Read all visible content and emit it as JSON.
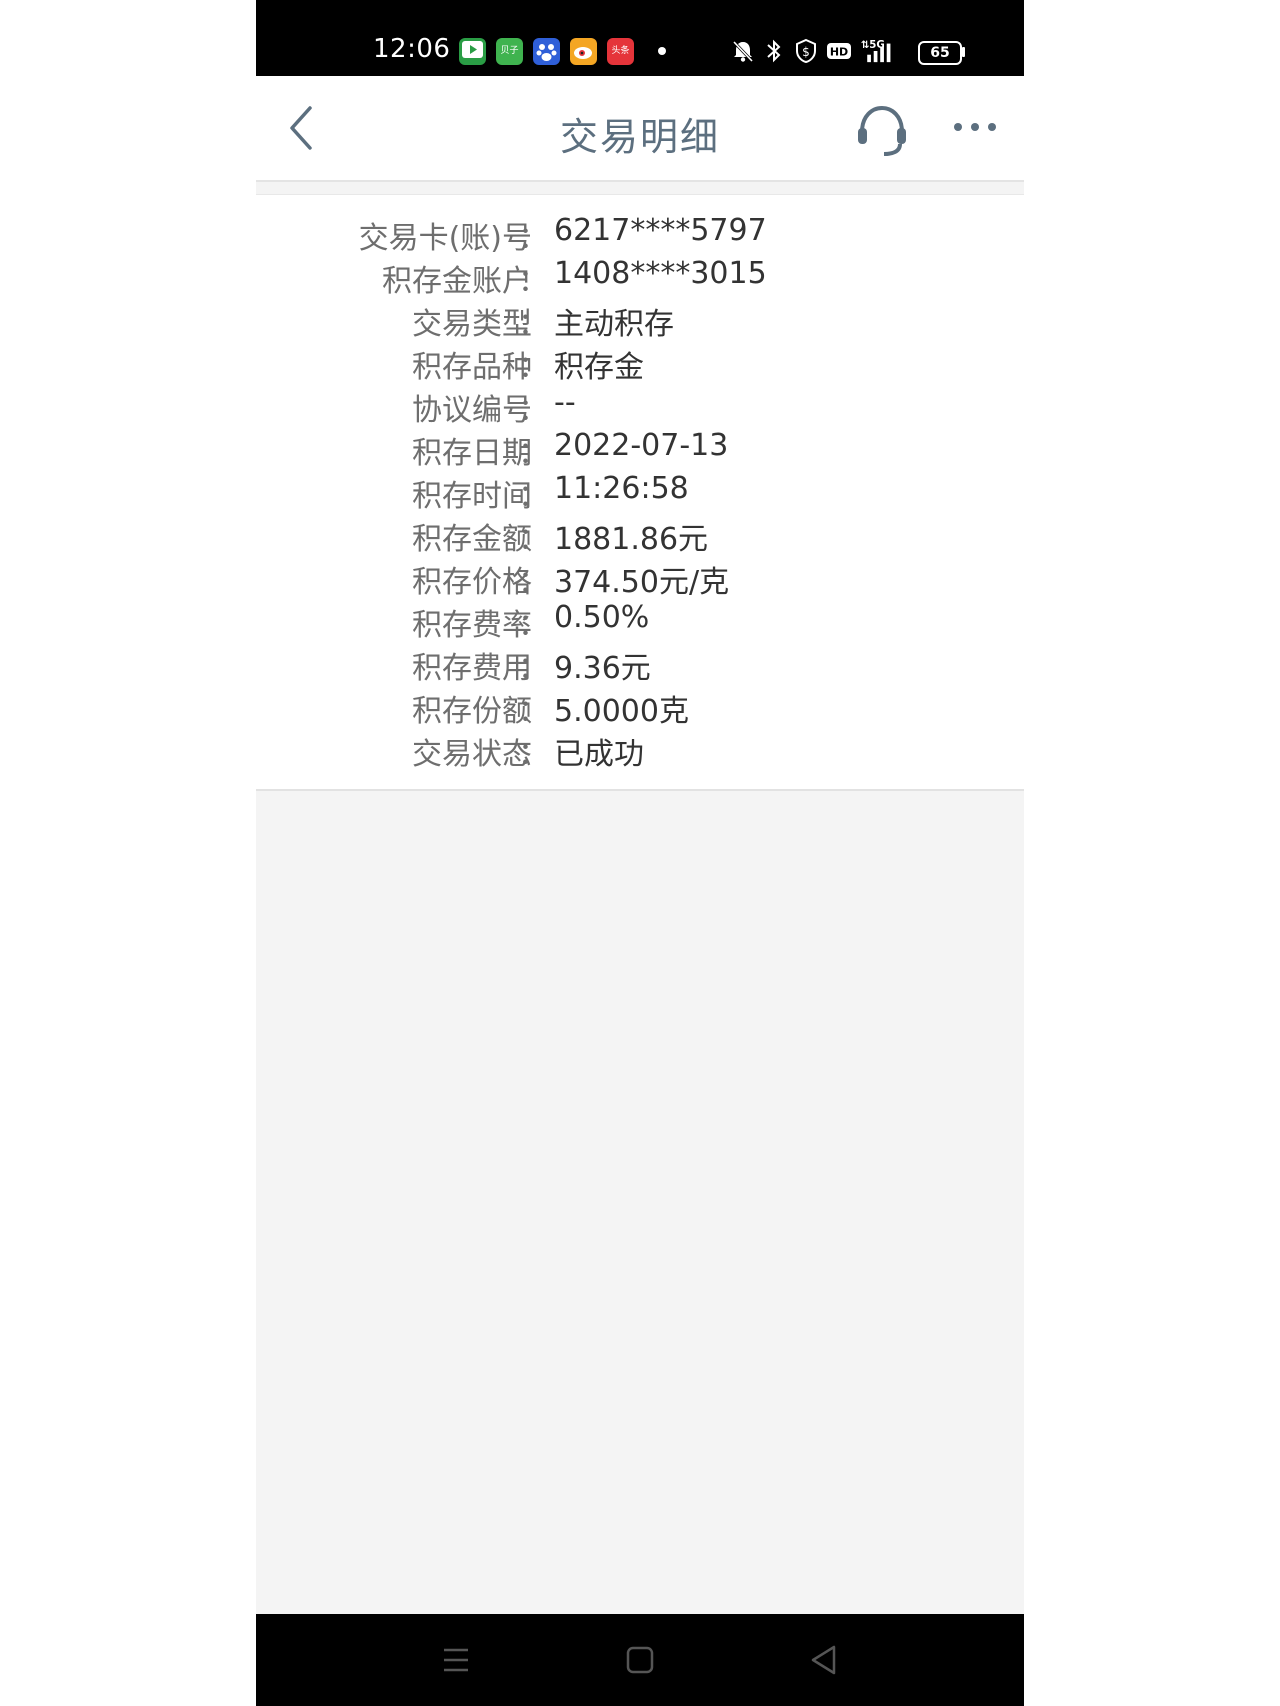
{
  "status_bar": {
    "time": "12:06",
    "app_icons": [
      {
        "name": "video-app-icon",
        "color": "#2a9d45"
      },
      {
        "name": "beizi-app-icon",
        "label": "贝子",
        "color": "#3fb34f"
      },
      {
        "name": "baidu-app-icon",
        "color": "#2f5fd8"
      },
      {
        "name": "weibo-app-icon",
        "color": "#f4a623"
      },
      {
        "name": "toutiao-app-icon",
        "label": "头条",
        "color": "#e5343a"
      }
    ],
    "network": "5G",
    "battery": "65"
  },
  "header": {
    "title": "交易明细",
    "title_color": "#5c6f7f"
  },
  "details": [
    {
      "label": "交易卡(账)号",
      "value": "6217****5797"
    },
    {
      "label": "积存金账户",
      "value": "1408****3015"
    },
    {
      "label": "交易类型",
      "value": "主动积存"
    },
    {
      "label": "积存品种",
      "value": "积存金"
    },
    {
      "label": "协议编号",
      "value": "--"
    },
    {
      "label": "积存日期",
      "value": "2022-07-13"
    },
    {
      "label": "积存时间",
      "value": "11:26:58"
    },
    {
      "label": "积存金额",
      "value": "1881.86元"
    },
    {
      "label": "积存价格",
      "value": "374.50元/克"
    },
    {
      "label": "积存费率",
      "value": "0.50%"
    },
    {
      "label": "积存费用",
      "value": "9.36元"
    },
    {
      "label": "积存份额",
      "value": "5.0000克"
    },
    {
      "label": "交易状态",
      "value": "已成功"
    }
  ],
  "colon": "："
}
